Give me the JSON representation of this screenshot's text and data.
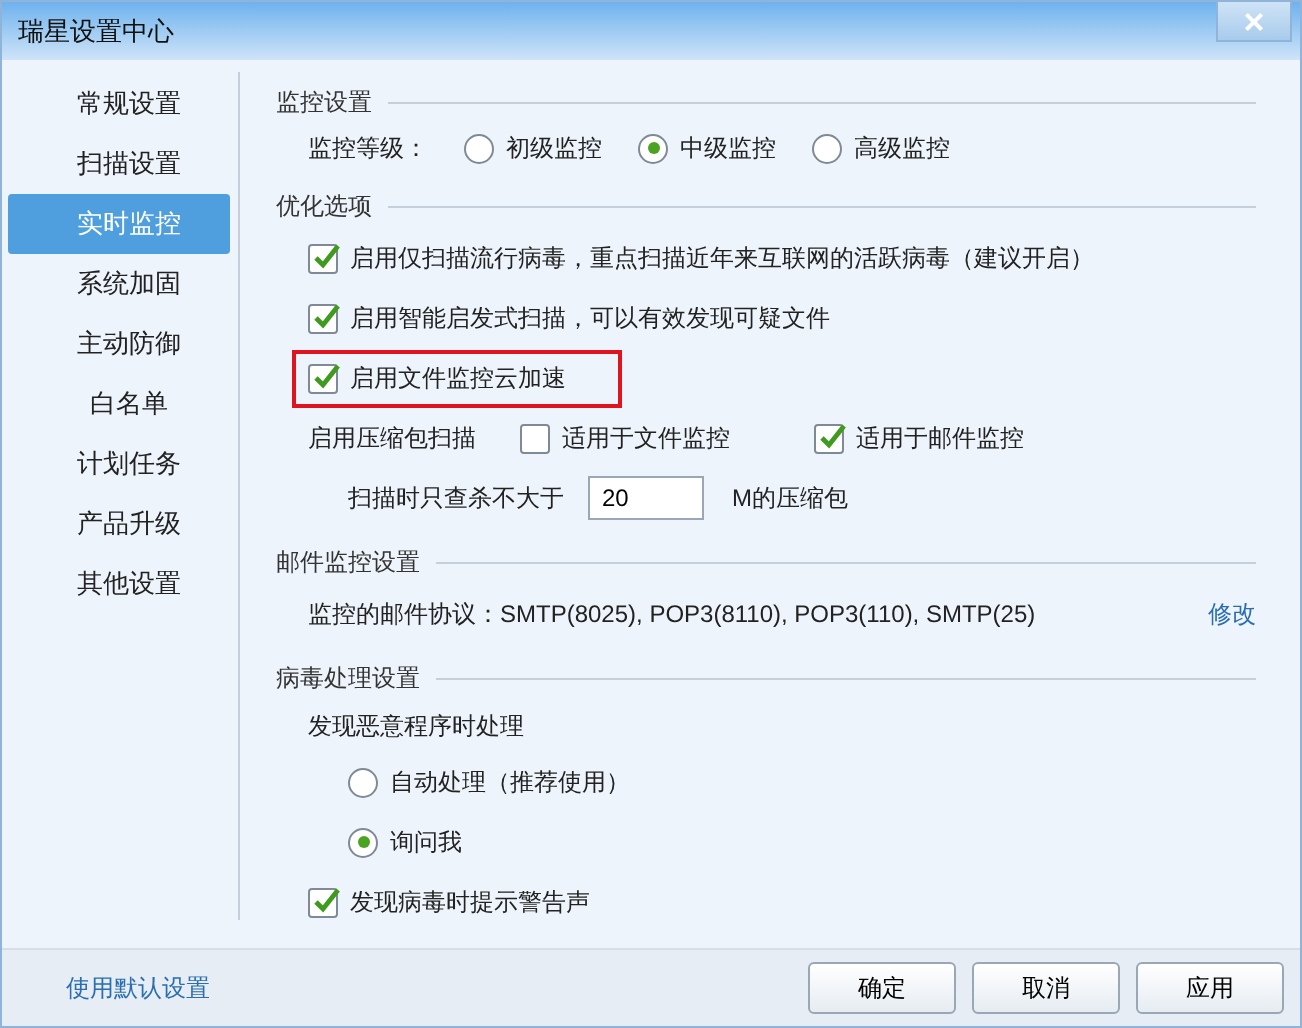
{
  "window": {
    "title": "瑞星设置中心",
    "close": "×"
  },
  "sidebar": {
    "items": [
      {
        "label": "常规设置",
        "selected": false
      },
      {
        "label": "扫描设置",
        "selected": false
      },
      {
        "label": "实时监控",
        "selected": true
      },
      {
        "label": "系统加固",
        "selected": false
      },
      {
        "label": "主动防御",
        "selected": false
      },
      {
        "label": "白名单",
        "selected": false
      },
      {
        "label": "计划任务",
        "selected": false
      },
      {
        "label": "产品升级",
        "selected": false
      },
      {
        "label": "其他设置",
        "selected": false
      }
    ]
  },
  "sections": [
    {
      "title": "监控设置",
      "rows": [
        {
          "kind": "radio_group",
          "label": "监控等级：",
          "options": [
            {
              "label": "初级监控",
              "selected": false
            },
            {
              "label": "中级监控",
              "selected": true
            },
            {
              "label": "高级监控",
              "selected": false
            }
          ]
        }
      ]
    },
    {
      "title": "优化选项",
      "rows": [
        {
          "kind": "checkbox",
          "label": "启用仅扫描流行病毒，重点扫描近年来互联网的活跃病毒（建议开启）",
          "checked": true,
          "highlighted": false
        },
        {
          "kind": "checkbox",
          "label": "启用智能启发式扫描，可以有效发现可疑文件",
          "checked": true,
          "highlighted": false
        },
        {
          "kind": "checkbox",
          "label": "启用文件监控云加速",
          "checked": true,
          "highlighted": true
        },
        {
          "kind": "checkbox_group",
          "label": "启用压缩包扫描",
          "options": [
            {
              "label": "适用于文件监控",
              "checked": false
            },
            {
              "label": "适用于邮件监控",
              "checked": true
            }
          ]
        },
        {
          "kind": "number",
          "label": "扫描时只查杀不大于",
          "value": "20",
          "suffix": "M的压缩包"
        }
      ]
    },
    {
      "title": "邮件监控设置",
      "rows": [
        {
          "kind": "text_link",
          "label": "监控的邮件协议：SMTP(8025), POP3(8110), POP3(110), SMTP(25)",
          "link": "修改"
        }
      ]
    },
    {
      "title": "病毒处理设置",
      "rows": [
        {
          "kind": "label",
          "label": "发现恶意程序时处理"
        },
        {
          "kind": "radio",
          "label": "自动处理（推荐使用）",
          "selected": false
        },
        {
          "kind": "radio",
          "label": "询问我",
          "selected": true
        },
        {
          "kind": "checkbox",
          "label": "发现病毒时提示警告声",
          "checked": true,
          "highlighted": false
        }
      ]
    }
  ],
  "footer": {
    "link": "使用默认设置",
    "buttons": [
      "确定",
      "取消",
      "应用"
    ]
  }
}
